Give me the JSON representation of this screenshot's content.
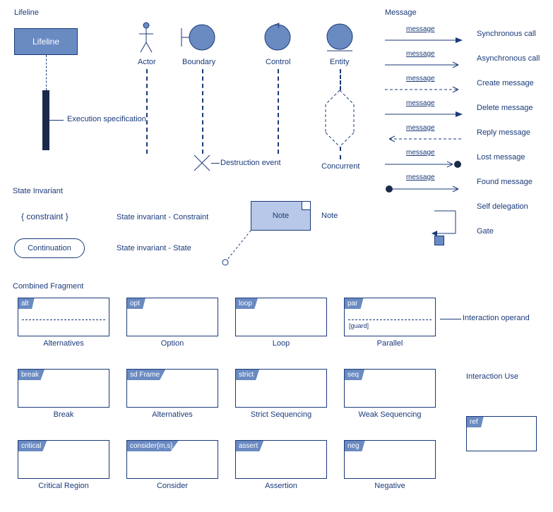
{
  "sections": {
    "lifeline": "Lifeline",
    "message": "Message",
    "state_invariant": "State Invariant",
    "combined_fragment": "Combined Fragment",
    "interaction_use": "Interaction Use"
  },
  "lifeline": {
    "box": "Lifeline",
    "exec_spec": "Execution specification",
    "actor": "Actor",
    "boundary": "Boundary",
    "control": "Control",
    "entity": "Entity",
    "destruction": "Destruction event",
    "concurrent": "Concurrent"
  },
  "state": {
    "constraint": "{ constraint }",
    "constraint_label": "State invariant - Constraint",
    "continuation": "Continuation",
    "continuation_label": "State invariant - State",
    "note": "Note",
    "note_label": "Note"
  },
  "messages": [
    {
      "type": "sync",
      "label": "message",
      "name": "Synchronous call"
    },
    {
      "type": "async",
      "label": "message",
      "name": "Asynchronous call"
    },
    {
      "type": "create",
      "label": "message",
      "name": "Create message"
    },
    {
      "type": "delete",
      "label": "message",
      "name": "Delete message"
    },
    {
      "type": "reply",
      "label": "message",
      "name": "Reply message"
    },
    {
      "type": "lost",
      "label": "message",
      "name": "Lost message"
    },
    {
      "type": "found",
      "label": "message",
      "name": "Found message"
    },
    {
      "type": "self",
      "label": "",
      "name": "Self delegation"
    },
    {
      "type": "gate",
      "label": "",
      "name": "Gate"
    }
  ],
  "fragments": [
    {
      "tag": "alt",
      "caption": "Alternatives",
      "dash": true
    },
    {
      "tag": "opt",
      "caption": "Option"
    },
    {
      "tag": "loop",
      "caption": "Loop"
    },
    {
      "tag": "par",
      "caption": "Parallel",
      "dash": true,
      "guard": "[guard]"
    },
    {
      "tag": "break",
      "caption": "Break"
    },
    {
      "tag": "sd Frame",
      "caption": "Alternatives"
    },
    {
      "tag": "strict",
      "caption": "Strict Sequencing"
    },
    {
      "tag": "seq",
      "caption": "Weak Sequencing"
    },
    {
      "tag": "critical",
      "caption": "Critical Region"
    },
    {
      "tag": "consider{m,s}",
      "caption": "Consider"
    },
    {
      "tag": "assert",
      "caption": "Assertion"
    },
    {
      "tag": "neg",
      "caption": "Negative"
    }
  ],
  "interaction_operand": "Interaction operand",
  "interaction_use_tag": "ref"
}
